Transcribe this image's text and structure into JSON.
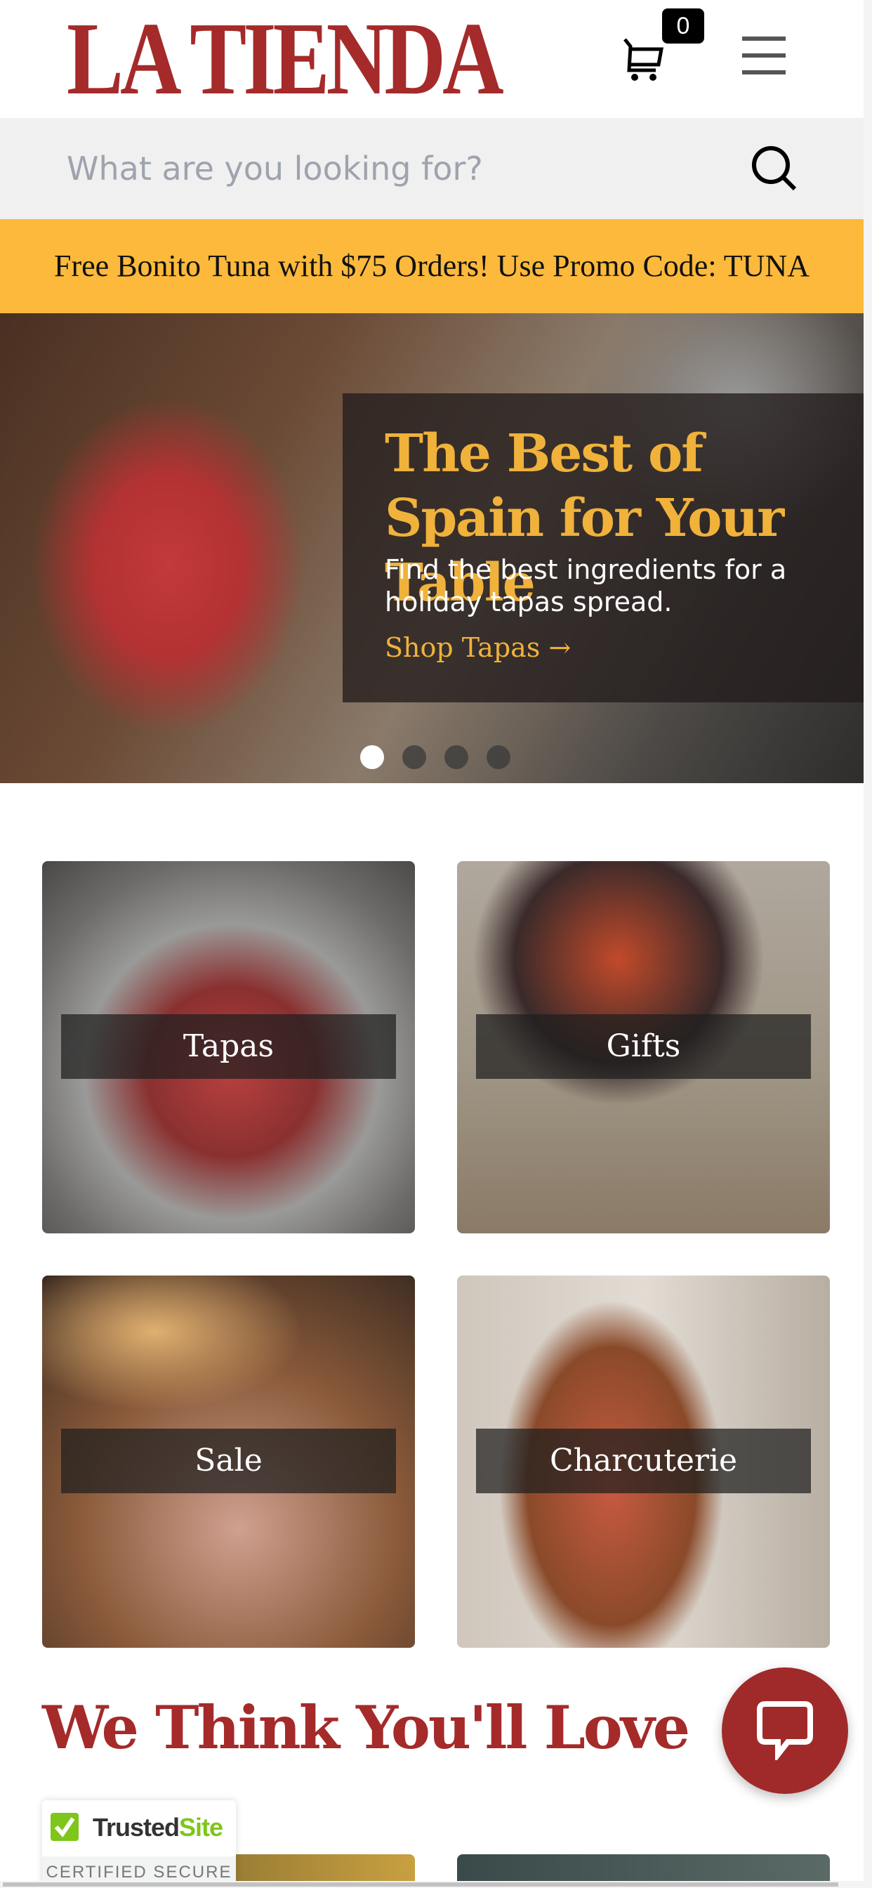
{
  "header": {
    "logo_text": "LA TIENDA",
    "cart_count": "0",
    "cart_icon": "cart-icon",
    "menu_icon": "hamburger-menu-icon"
  },
  "search": {
    "placeholder": "What are you looking for?",
    "value": "",
    "icon": "search-icon"
  },
  "promo": {
    "text": "Free Bonito Tuna with $75 Orders! Use Promo Code: TUNA"
  },
  "hero": {
    "title": "The Best of Spain for Your Table",
    "subtitle": "Find the best ingredients for a holiday tapas spread.",
    "cta": "Shop Tapas →",
    "slides": 4,
    "active_slide": 1
  },
  "categories": [
    {
      "label": "Tapas"
    },
    {
      "label": "Gifts"
    },
    {
      "label": "Sale"
    },
    {
      "label": "Charcuterie"
    }
  ],
  "recommendations": {
    "title": "We Think You'll Love"
  },
  "trust_badge": {
    "brand_a": "Trusted",
    "brand_b": "Site",
    "subtitle": "CERTIFIED SECURE"
  },
  "colors": {
    "brand": "#a52a2a",
    "promo": "#fdb93b",
    "hero_accent": "#f0b23a",
    "chat": "#a02a2a"
  }
}
